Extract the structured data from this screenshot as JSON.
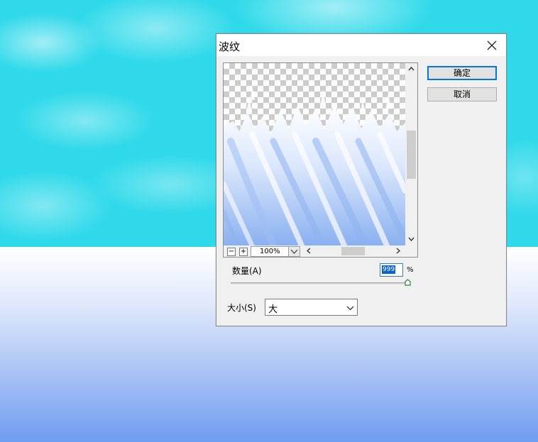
{
  "dialog": {
    "title": "波纹",
    "ok_label": "确定",
    "cancel_label": "取消"
  },
  "preview": {
    "zoom_minus": "−",
    "zoom_plus": "+",
    "zoom_value": "100%"
  },
  "amount": {
    "label": "数量(A)",
    "value": "999",
    "unit": "%"
  },
  "size": {
    "label": "大小(S)",
    "value": "大"
  },
  "colors": {
    "sky": "#2fd9ea",
    "default_button_border": "#0078d7",
    "selection": "#0a64c8"
  }
}
